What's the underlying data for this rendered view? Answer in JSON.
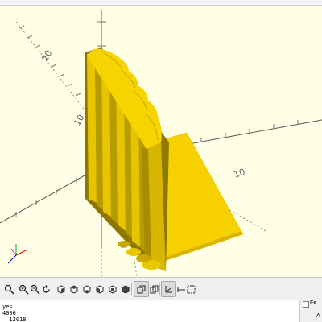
{
  "viewport": {
    "axis_labels": [
      "20",
      "10",
      "10"
    ],
    "part_color": "#f5d100",
    "bg_color": "#ffffe5"
  },
  "toolbar": {
    "items": [
      {
        "name": "zoom-all-icon"
      },
      {
        "name": "zoom-in-icon"
      },
      {
        "name": "zoom-out-icon"
      },
      {
        "name": "reset-view-icon"
      },
      {
        "name": "view-right-icon"
      },
      {
        "name": "view-top-icon"
      },
      {
        "name": "view-bottom-icon"
      },
      {
        "name": "view-left-icon"
      },
      {
        "name": "view-front-icon"
      },
      {
        "name": "view-back-icon"
      },
      {
        "name": "view-diagonal-icon"
      },
      {
        "name": "perspective-icon"
      },
      {
        "name": "orthogonal-icon"
      },
      {
        "name": "show-axes-icon"
      },
      {
        "name": "show-crosshairs-icon"
      }
    ]
  },
  "console": {
    "lines": [
      "yes",
      "4006",
      "  12018"
    ]
  },
  "right_panel": {
    "label_top": "Fe",
    "label_bottom": "A"
  }
}
